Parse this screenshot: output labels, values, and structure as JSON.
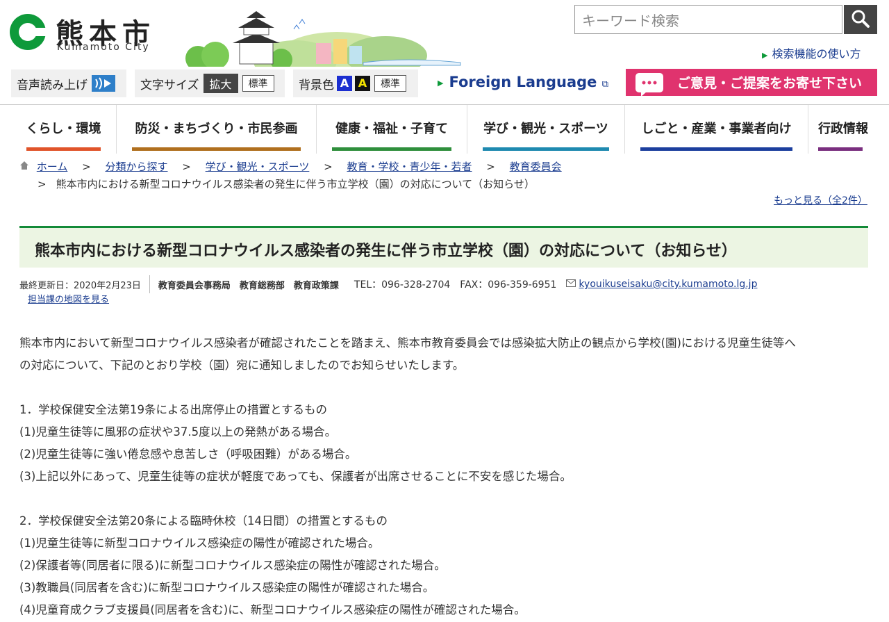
{
  "header": {
    "logo_kanji": "熊本市",
    "logo_roman": "Kumamoto City",
    "search_placeholder": "キーワード検索",
    "search_howto": "検索機能の使い方"
  },
  "toolbar": {
    "speech_label": "音声読み上げ",
    "fontsize_label": "文字サイズ",
    "fontsize_large": "拡大",
    "fontsize_std": "標準",
    "bg_label": "背景色",
    "bg_a1": "A",
    "bg_a2": "A",
    "bg_std": "標準",
    "foreign": "Foreign Language",
    "opinion": "ご意見・ご提案をお寄せ下さい"
  },
  "nav": [
    {
      "label": "くらし・環境",
      "color": "#e0542a"
    },
    {
      "label": "防災・まちづくり・市民参画",
      "color": "#b06f1e"
    },
    {
      "label": "健康・福祉・子育て",
      "color": "#2f8f3c"
    },
    {
      "label": "学び・観光・スポーツ",
      "color": "#1f8ab0"
    },
    {
      "label": "しごと・産業・事業者向け",
      "color": "#1c3f9e"
    },
    {
      "label": "行政情報",
      "color": "#7a2f7f"
    }
  ],
  "breadcrumb": {
    "home": "ホーム",
    "c1": "分類から探す",
    "c2": "学び・観光・スポーツ",
    "c3": "教育・学校・青少年・若者",
    "c4": "教育委員会",
    "current": "熊本市内における新型コロナウイルス感染者の発生に伴う市立学校（園）の対応について（お知らせ）",
    "sep": ">",
    "more": "もっと見る（全2件）"
  },
  "article": {
    "title": "熊本市内における新型コロナウイルス感染者の発生に伴う市立学校（園）の対応について（お知らせ）",
    "updated": "最終更新日：2020年2月23日",
    "dept": "教育委員会事務局　教育総務部　教育政策課",
    "tel": "TEL：096-328-2704",
    "fax": "FAX：096-359-6951",
    "email": "kyouikuseisaku@city.kumamoto.lg.jp",
    "map_link": "担当課の地図を見る",
    "intro1": "熊本市内において新型コロナウイルス感染者が確認されたことを踏まえ、熊本市教育委員会では感染拡大防止の観点から学校(園)における児童生徒等へ",
    "intro2": "の対応について、下記のとおり学校（園）宛に通知しましたのでお知らせいたします。",
    "s1_head": "1．学校保健安全法第19条による出席停止の措置とするもの",
    "s1_1": "(1)児童生徒等に風邪の症状や37.5度以上の発熱がある場合。",
    "s1_2": "(2)児童生徒等に強い倦怠感や息苦しさ（呼吸困難）がある場合。",
    "s1_3": "(3)上記以外にあって、児童生徒等の症状が軽度であっても、保護者が出席させることに不安を感じた場合。",
    "s2_head": "2．学校保健安全法第20条による臨時休校（14日間）の措置とするもの",
    "s2_1": "(1)児童生徒等に新型コロナウイルス感染症の陽性が確認された場合。",
    "s2_2": "(2)保護者等(同居者に限る)に新型コロナウイルス感染症の陽性が確認された場合。",
    "s2_3": "(3)教職員(同居者を含む)に新型コロナウイルス感染症の陽性が確認された場合。",
    "s2_4": "(4)児童育成クラブ支援員(同居者を含む)に、新型コロナウイルス感染症の陽性が確認された場合。"
  }
}
